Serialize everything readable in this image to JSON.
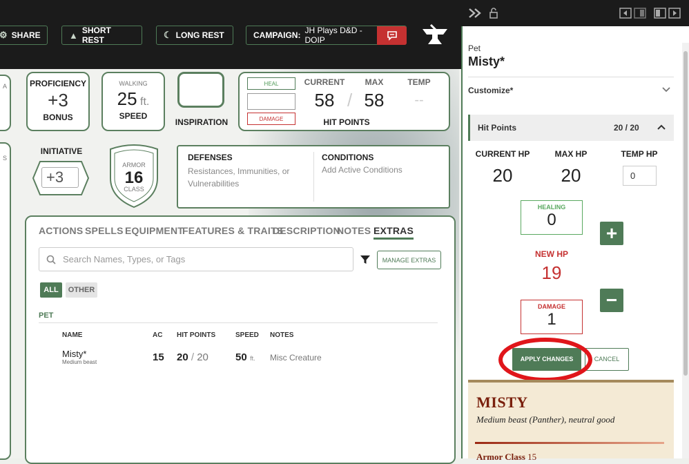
{
  "topbar": {
    "share": "SHARE",
    "short_rest": "SHORT REST",
    "long_rest": "LONG REST",
    "campaign_label": "CAMPAIGN:",
    "campaign_name": "JH Plays D&D - DOIP"
  },
  "stats": {
    "proficiency_label": "PROFICIENCY",
    "proficiency_value": "+3",
    "proficiency_sub": "BONUS",
    "walking_label": "WALKING",
    "speed_value": "25",
    "speed_unit": "ft.",
    "speed_label": "SPEED",
    "inspiration_label": "INSPIRATION",
    "heal_btn": "HEAL",
    "damage_btn": "DAMAGE",
    "current_label": "CURRENT",
    "max_label": "MAX",
    "temp_label": "TEMP",
    "current_hp": "58",
    "max_hp": "58",
    "temp_hp": "--",
    "hit_points_label": "HIT POINTS",
    "initiative_label": "INITIATIVE",
    "initiative_value": "+3",
    "armor_label": "ARMOR",
    "armor_value": "16",
    "armor_sub": "CLASS",
    "defenses_title": "DEFENSES",
    "defenses_text": "Resistances, Immunities, or Vulnerabilities",
    "conditions_title": "CONDITIONS",
    "conditions_text": "Add Active Conditions",
    "left_partial_a": "A",
    "left_partial_s": "S"
  },
  "tabs": [
    "ACTIONS",
    "SPELLS",
    "EQUIPMENT",
    "FEATURES & TRAITS",
    "DESCRIPTION",
    "NOTES",
    "EXTRAS"
  ],
  "extras": {
    "search_placeholder": "Search Names, Types, or Tags",
    "manage_btn": "MANAGE EXTRAS",
    "filter_all": "ALL",
    "filter_other": "OTHER",
    "section": "PET",
    "columns": [
      "NAME",
      "AC",
      "HIT POINTS",
      "SPEED",
      "NOTES"
    ],
    "row": {
      "name": "Misty*",
      "subtitle": "Medium beast",
      "ac": "15",
      "hp_current": "20",
      "hp_sep": "/",
      "hp_max": "20",
      "speed": "50",
      "speed_unit": "ft.",
      "notes": "Misc Creature"
    }
  },
  "panel": {
    "type": "Pet",
    "name": "Misty*",
    "customize": "Customize*",
    "hp_header": "Hit Points",
    "hp_summary": "20 / 20",
    "current_hp_label": "CURRENT HP",
    "max_hp_label": "MAX HP",
    "temp_hp_label": "TEMP HP",
    "current_hp": "20",
    "max_hp": "20",
    "temp_hp_value": "0",
    "healing_label": "HEALING",
    "healing_value": "0",
    "new_hp_label": "NEW HP",
    "new_hp_value": "19",
    "damage_label": "DAMAGE",
    "damage_value": "1",
    "apply_btn": "APPLY CHANGES",
    "cancel_btn": "CANCEL",
    "statblock_name": "MISTY",
    "statblock_sub": "Medium beast (Panther), neutral good",
    "armor_class_label": "Armor Class",
    "armor_class_value": "15"
  },
  "colors": {
    "accent": "#4f7b57",
    "danger": "#c53131",
    "highlight_ring": "#e0161b"
  }
}
